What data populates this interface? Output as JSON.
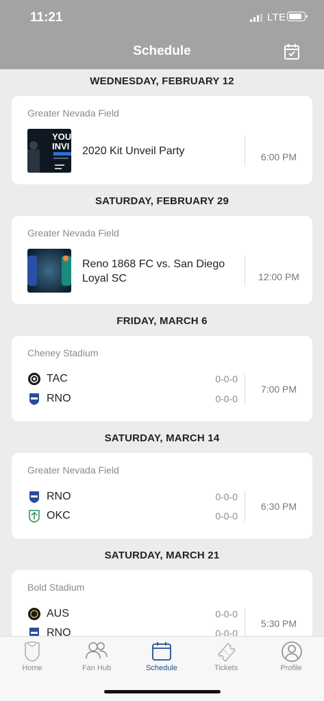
{
  "status": {
    "time": "11:21",
    "network": "LTE"
  },
  "header": {
    "title": "Schedule"
  },
  "days": [
    {
      "date": "WEDNESDAY, FEBRUARY 12",
      "event": {
        "venue": "Greater Nevada Field",
        "name": "2020 Kit Unveil Party",
        "time": "6:00 PM",
        "thumb_text_1": "YOU",
        "thumb_text_2": "INVI"
      }
    },
    {
      "date": "SATURDAY, FEBRUARY 29",
      "event": {
        "venue": "Greater Nevada Field",
        "name_line1": "Reno 1868 FC vs. San Diego",
        "name_line2": "Loyal SC",
        "time": "12:00 PM"
      }
    },
    {
      "date": "FRIDAY, MARCH 6",
      "match": {
        "venue": "Cheney Stadium",
        "time": "7:00 PM",
        "teams": [
          {
            "abbr": "TAC",
            "record": "0-0-0"
          },
          {
            "abbr": "RNO",
            "record": "0-0-0"
          }
        ]
      }
    },
    {
      "date": "SATURDAY, MARCH 14",
      "match": {
        "venue": "Greater Nevada Field",
        "time": "6:30 PM",
        "teams": [
          {
            "abbr": "RNO",
            "record": "0-0-0"
          },
          {
            "abbr": "OKC",
            "record": "0-0-0"
          }
        ]
      }
    },
    {
      "date": "SATURDAY, MARCH 21",
      "match": {
        "venue": "Bold Stadium",
        "time": "5:30 PM",
        "teams": [
          {
            "abbr": "AUS",
            "record": "0-0-0"
          },
          {
            "abbr": "RNO",
            "record": "0-0-0"
          }
        ]
      }
    }
  ],
  "tabs": [
    {
      "label": "Home",
      "icon": "shield-icon"
    },
    {
      "label": "Fan Hub",
      "icon": "people-icon"
    },
    {
      "label": "Schedule",
      "icon": "calendar-icon",
      "active": true
    },
    {
      "label": "Tickets",
      "icon": "ticket-icon"
    },
    {
      "label": "Profile",
      "icon": "profile-icon"
    }
  ],
  "colors": {
    "header": "#a3a3a3",
    "accent": "#1f4d8f",
    "background": "#ececec"
  }
}
